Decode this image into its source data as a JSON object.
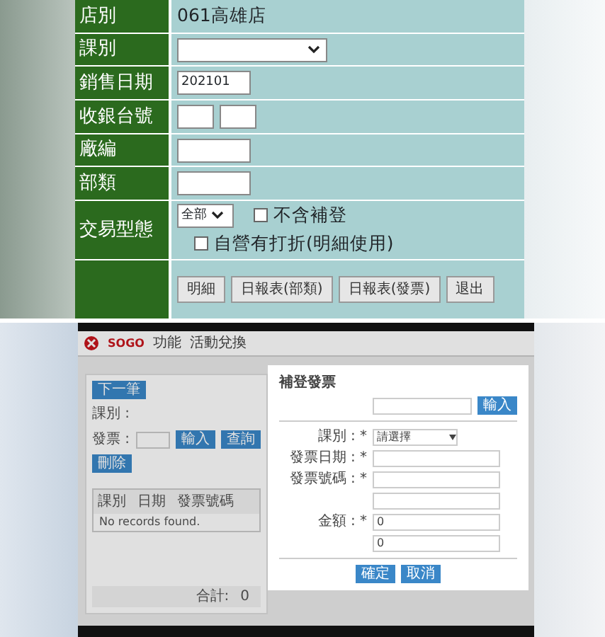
{
  "report_form": {
    "rows": [
      {
        "kind": "text",
        "label": "店別",
        "value": "061高雄店"
      },
      {
        "kind": "select",
        "label": "課別"
      },
      {
        "kind": "input",
        "label": "銷售日期",
        "value": "202101"
      },
      {
        "kind": "pair",
        "label": "收銀台號"
      },
      {
        "kind": "input",
        "label": "廠編"
      },
      {
        "kind": "input",
        "label": "部類"
      },
      {
        "kind": "type",
        "label": "交易型態",
        "select": "全部",
        "checks": [
          {
            "label": "不含補登",
            "checked": false
          },
          {
            "label": "自營有打折(明細使用)",
            "checked": false
          }
        ]
      },
      {
        "kind": "buttons",
        "buttons": [
          "明細",
          "日報表(部類)",
          "日報表(發票)",
          "退出"
        ]
      }
    ]
  },
  "app": {
    "logo": "SOGO",
    "nav": [
      "功能",
      "活動兌換"
    ],
    "left": {
      "next_button": "下一筆",
      "fields": [
        {
          "label": "課別 :"
        },
        {
          "label": "發票 :"
        }
      ],
      "field_buttons": [
        "輸入",
        "查詢"
      ],
      "delete_button": "刪除",
      "table": {
        "columns": [
          "課別",
          "日期",
          "發票號碼"
        ],
        "empty": "No records found.",
        "total_label": "合計:",
        "total": "0"
      }
    },
    "modal": {
      "title": "補登發票",
      "qr_button": "輸入",
      "fields": [
        {
          "kind": "select",
          "label": "課別 : *",
          "value": "請選擇"
        },
        {
          "kind": "input",
          "label": "發票日期 : *"
        },
        {
          "kind": "input",
          "label": "發票號碼 : *"
        },
        {
          "kind": "input"
        },
        {
          "kind": "input",
          "label": "金額 : *",
          "value": "0"
        },
        {
          "kind": "input",
          "value": "0"
        }
      ],
      "buttons": [
        "確定",
        "取消"
      ]
    }
  }
}
